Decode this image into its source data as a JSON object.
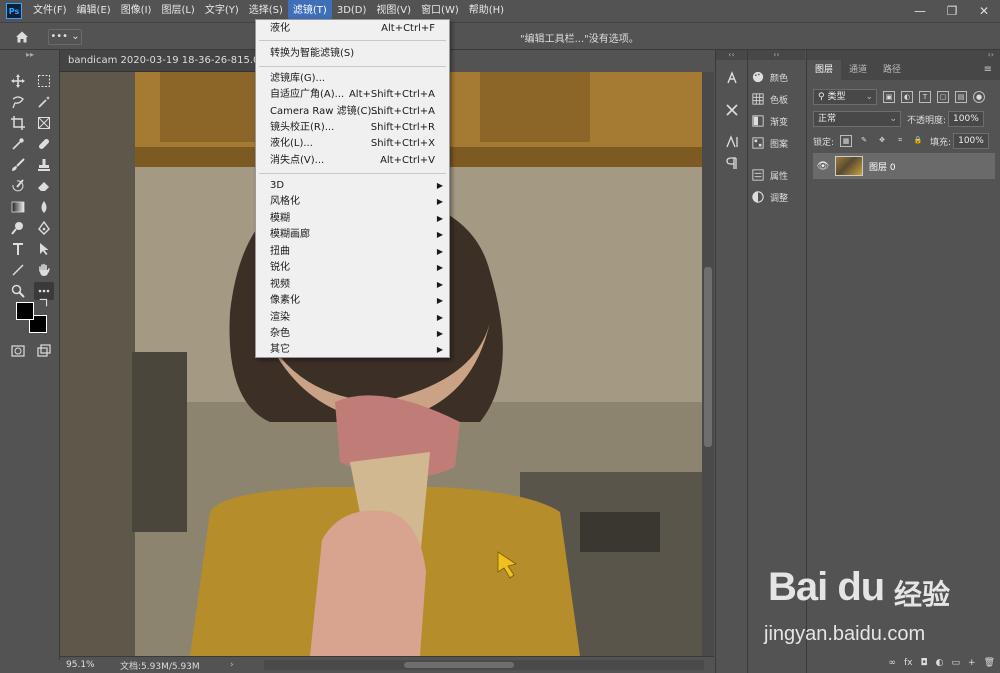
{
  "app": {
    "logo_text": "Ps"
  },
  "menubar": {
    "items": [
      {
        "label": "文件(F)"
      },
      {
        "label": "编辑(E)"
      },
      {
        "label": "图像(I)"
      },
      {
        "label": "图层(L)"
      },
      {
        "label": "文字(Y)"
      },
      {
        "label": "选择(S)"
      },
      {
        "label": "滤镜(T)"
      },
      {
        "label": "3D(D)"
      },
      {
        "label": "视图(V)"
      },
      {
        "label": "窗口(W)"
      },
      {
        "label": "帮助(H)"
      }
    ],
    "window_controls": {
      "minimize": "—",
      "restore": "❐",
      "close": "✕"
    }
  },
  "options_bar": {
    "more_label": "••• ⌄",
    "status_text": "\"编辑工具栏...\"没有选项。"
  },
  "document": {
    "tab_title": "bandicam 2020-03-19 18-36-26-815.00_00_2",
    "zoom": "95.1%",
    "doc_info": "文档:5.93M/5.93M",
    "status_arrow": "›"
  },
  "filter_menu": {
    "items": [
      {
        "label": "液化",
        "shortcut": "Alt+Ctrl+F"
      },
      {
        "label": "转换为智能滤镜(S)",
        "shortcut": ""
      },
      {
        "label": "滤镜库(G)...",
        "shortcut": ""
      },
      {
        "label": "自适应广角(A)...",
        "shortcut": "Alt+Shift+Ctrl+A"
      },
      {
        "label": "Camera Raw 滤镜(C)...",
        "shortcut": "Shift+Ctrl+A"
      },
      {
        "label": "镜头校正(R)...",
        "shortcut": "Shift+Ctrl+R"
      },
      {
        "label": "液化(L)...",
        "shortcut": "Shift+Ctrl+X"
      },
      {
        "label": "消失点(V)...",
        "shortcut": "Alt+Ctrl+V"
      },
      {
        "label": "3D",
        "submenu": "▶"
      },
      {
        "label": "风格化",
        "submenu": "▶"
      },
      {
        "label": "模糊",
        "submenu": "▶"
      },
      {
        "label": "模糊画廊",
        "submenu": "▶"
      },
      {
        "label": "扭曲",
        "submenu": "▶"
      },
      {
        "label": "锐化",
        "submenu": "▶"
      },
      {
        "label": "视频",
        "submenu": "▶"
      },
      {
        "label": "像素化",
        "submenu": "▶"
      },
      {
        "label": "渲染",
        "submenu": "▶"
      },
      {
        "label": "杂色",
        "submenu": "▶"
      },
      {
        "label": "其它",
        "submenu": "▶"
      }
    ]
  },
  "dock_panels": {
    "collapse": "‹‹",
    "items": [
      {
        "label": "颜色"
      },
      {
        "label": "色板"
      },
      {
        "label": "渐变"
      },
      {
        "label": "图案"
      },
      {
        "label": "属性"
      },
      {
        "label": "调整"
      }
    ]
  },
  "layers_panel": {
    "collapse": "››",
    "tabs": [
      {
        "label": "图层"
      },
      {
        "label": "通道"
      },
      {
        "label": "路径"
      }
    ],
    "menu_icon": "≡",
    "filter_kind": "类型",
    "blend_mode": "正常",
    "opacity_label": "不透明度:",
    "opacity_value": "100%",
    "lock_label": "锁定:",
    "fill_label": "填充:",
    "fill_value": "100%",
    "layer": {
      "name": "图层 0",
      "visible_icon": "👁"
    },
    "footer_icons": [
      "∞",
      "fx",
      "◘",
      "◐",
      "▭",
      "+",
      "🗑"
    ]
  },
  "watermark": {
    "logo": "Bai du",
    "cn": "经验",
    "url": "jingyan.baidu.com"
  },
  "colors": {
    "menu_highlight": "#3f6fb8",
    "annotation_arrow": "#e8282c",
    "panel_bg": "#535353"
  }
}
